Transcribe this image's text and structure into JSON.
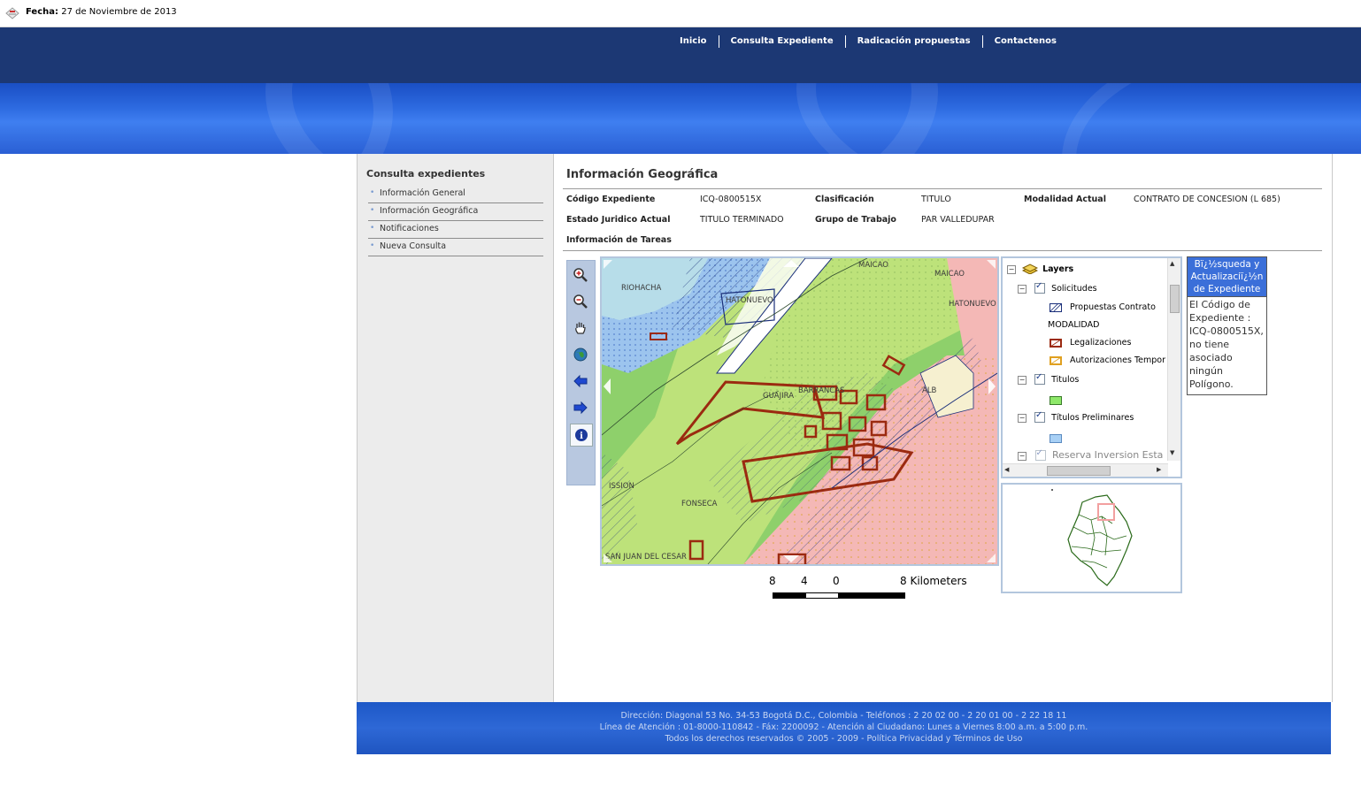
{
  "header": {
    "date_label": "Fecha:",
    "date_value": "27 de Noviembre de 2013"
  },
  "nav": [
    {
      "label": "Inicio"
    },
    {
      "label": "Consulta Expediente"
    },
    {
      "label": "Radicación propuestas"
    },
    {
      "label": "Contactenos"
    }
  ],
  "sidebar": {
    "title": "Consulta expedientes",
    "items": [
      {
        "label": "Información General"
      },
      {
        "label": "Información Geográfica"
      },
      {
        "label": "Notificaciones"
      },
      {
        "label": "Nueva Consulta"
      }
    ]
  },
  "main": {
    "heading": "Información Geográfica",
    "fields": {
      "codigo_label": "Código Expediente",
      "codigo_value": "ICQ-0800515X",
      "clasificacion_label": "Clasificación",
      "clasificacion_value": "TITULO",
      "modalidad_label": "Modalidad Actual",
      "modalidad_value": "CONTRATO DE CONCESION (L 685)",
      "estado_label": "Estado Juridico Actual",
      "estado_value": "TITULO TERMINADO",
      "grupo_label": "Grupo de Trabajo",
      "grupo_value": "PAR VALLEDUPAR",
      "tareas_label": "Información de Tareas"
    }
  },
  "map": {
    "labels": {
      "riohacha": "RIOHACHA",
      "maicao1": "MAICAO",
      "maicao2": "MAICAO",
      "hatonuevo": "HATONUEVO",
      "guajira": "GUAJIRA",
      "barrancas": "BARRANCAS",
      "fonseca": "FONSECA",
      "sanjuan": "SAN JUAN DEL CESAR",
      "ission": "ISSION",
      "alb": "ALB",
      "hatonuevo2": "HATONUEVO"
    },
    "scale": {
      "t1": "8",
      "t2": "4",
      "t3": "0",
      "t4": "8 Kilometers"
    }
  },
  "layers": {
    "title": "Layers",
    "items": {
      "solicitudes": "Solicitudes",
      "propuestas": "Propuestas Contrato",
      "modalidad": "MODALIDAD",
      "legalizaciones": "Legalizaciones",
      "autorizaciones": "Autorizaciones Tempor",
      "titulos": "Titulos",
      "titulos_prelim": "Títulos Preliminares",
      "reserva": "Reserva Inversion Esta"
    }
  },
  "infobox": {
    "header": "Bï¿½squeda y Actualizaciï¿½n de Expediente",
    "body": "El Código de Expediente : ICQ-0800515X, no tiene asociado ningún Polígono."
  },
  "footer": {
    "line1": "Dirección: Diagonal 53 No. 34-53  Bogotá D.C., Colombia   - Teléfonos : 2 20 02 00 - 2 20 01 00  - 2 22 18 11",
    "line2": "Línea de Atención : 01-8000-110842 - Fáx: 2200092  - Atención al Ciudadano:  Lunes a Viernes  8:00 a.m. a 5:00  p.m.",
    "line3": "Todos los derechos reservados © 2005 - 2009 - Política Privacidad y Términos de Uso"
  },
  "colors": {
    "nav_bg": "#1c3874",
    "banner": "#2d6ae0",
    "footer": "#1d58c7",
    "infobox_header": "#3b6fd9"
  }
}
